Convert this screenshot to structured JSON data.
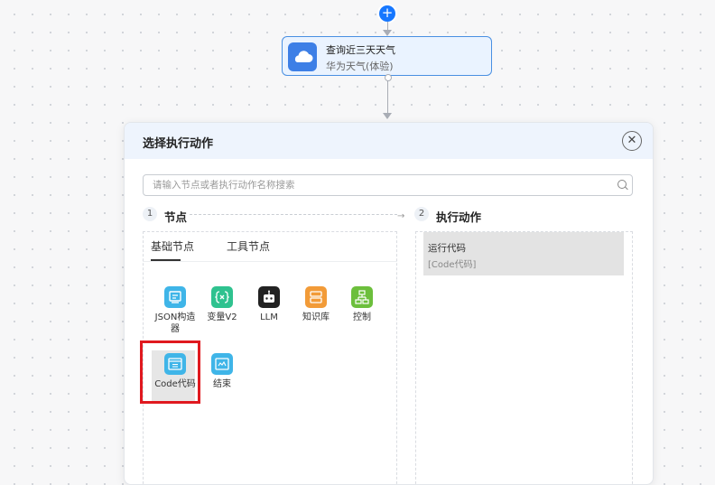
{
  "canvas": {
    "add_node_label": "+",
    "node": {
      "title": "查询近三天天气",
      "subtitle": "华为天气(体验)",
      "icon": "cloud-icon"
    }
  },
  "panel": {
    "title": "选择执行动作",
    "close_label": "✕",
    "search_placeholder": "请输入节点或者执行动作名称搜索",
    "step1": {
      "num": "1",
      "label": "节点"
    },
    "step2": {
      "num": "2",
      "label": "执行动作"
    },
    "tabs": [
      {
        "label": "基础节点",
        "active": true
      },
      {
        "label": "工具节点",
        "active": false
      }
    ],
    "tools": [
      {
        "label": "JSON构造器",
        "icon": "json-builder-icon",
        "color": "#3fb5e8"
      },
      {
        "label": "变量V2",
        "icon": "variable-icon",
        "color": "#2fc28f"
      },
      {
        "label": "LLM",
        "icon": "robot-icon",
        "color": "#222222"
      },
      {
        "label": "知识库",
        "icon": "database-icon",
        "color": "#f29b38"
      },
      {
        "label": "控制",
        "icon": "flow-control-icon",
        "color": "#6cbf3c"
      },
      {
        "label": "Code代码",
        "icon": "code-icon",
        "color": "#3fb5e8"
      },
      {
        "label": "结束",
        "icon": "end-icon",
        "color": "#3fb5e8"
      }
    ],
    "action": {
      "name": "运行代码",
      "sub": "[Code代码]"
    }
  },
  "colors": {
    "accent": "#1677ff",
    "highlight": "#e0191f"
  }
}
